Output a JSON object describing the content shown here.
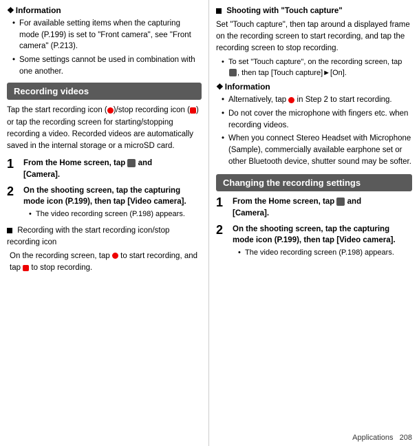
{
  "left": {
    "info_title": "Information",
    "info_bullets": [
      "For available setting items when the capturing mode (P.199) is set to \"Front camera\", see \"Front camera\" (P.213).",
      "Some settings cannot be used in combination with one another."
    ],
    "section_header": "Recording videos",
    "main_text": "Tap the start recording icon (●)/stop recording icon (■) or tap the recording screen for starting/stopping recording a video. Recorded videos are automatically saved in the internal storage or a microSD card.",
    "step1_num": "1",
    "step1_text": "From the Home screen, tap",
    "step1_bold": "[Camera].",
    "step1_icon": "grid-icon",
    "step1_and": "and",
    "step2_num": "2",
    "step2_text": "On the shooting screen, tap the capturing mode icon (P.199), then tap [Video camera].",
    "step2_sub": "The video recording screen (P.198) appears.",
    "black_sq1_title": "Recording with the start recording icon/stop recording icon",
    "black_sq1_text": "On the recording screen, tap",
    "black_sq1_text2": "to start recording, and tap",
    "black_sq1_text3": "to stop recording."
  },
  "right": {
    "black_sq2_title": "Shooting with \"Touch capture\"",
    "black_sq2_text": "Set \"Touch capture\", then tap around a displayed frame on the recording screen to start recording, and tap the recording screen to stop recording.",
    "black_sq2_sub1": "To set \"Touch capture\", on the recording screen, tap",
    "black_sq2_sub1b": ", then tap [Touch capture]►[On].",
    "info_title": "Information",
    "info_bullets": [
      "Alternatively, tap ● in Step 2 to start recording.",
      "Do not cover the microphone with fingers etc. when recording videos.",
      "When you connect Stereo Headset with Microphone (Sample), commercially available earphone set or other Bluetooth device, shutter sound may be softer."
    ],
    "section_header": "Changing the recording settings",
    "step1_num": "1",
    "step1_text": "From the Home screen, tap",
    "step1_bold": "[Camera].",
    "step1_and": "and",
    "step2_num": "2",
    "step2_text": "On the shooting screen, tap the capturing mode icon (P.199), then tap [Video camera].",
    "step2_sub": "The video recording screen (P.198) appears.",
    "footer_text": "Applications",
    "footer_page": "208"
  }
}
